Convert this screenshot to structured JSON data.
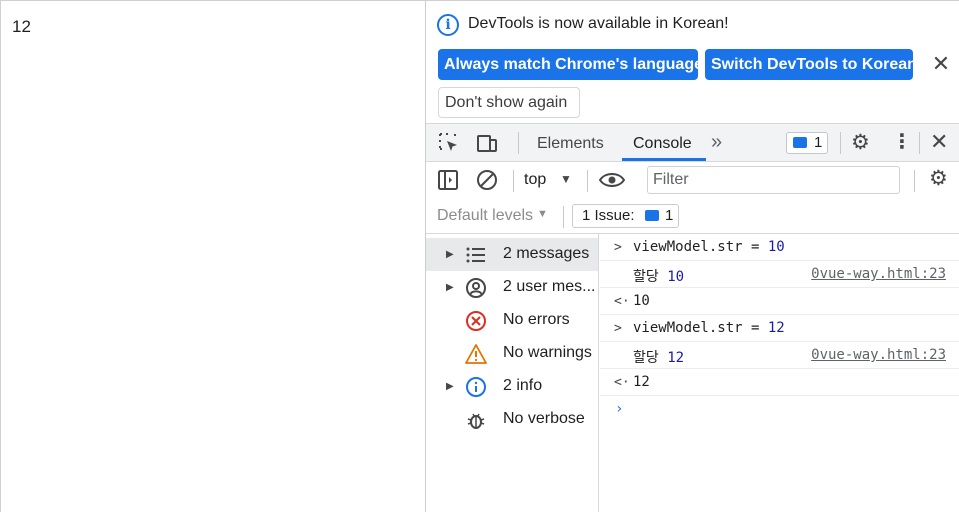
{
  "page": {
    "content_text": "12"
  },
  "infobar": {
    "message": "DevTools is now available in Korean!",
    "match_button": "Always match Chrome's language",
    "switch_button": "Switch DevTools to Korean",
    "dont_show_button": "Don't show again",
    "close_label": "✕"
  },
  "toolbar": {
    "tabs": [
      {
        "label": "Elements",
        "selected": false
      },
      {
        "label": "Console",
        "selected": true
      }
    ],
    "more_tabs_label": "»",
    "issues_count": "1",
    "close_label": "✕"
  },
  "console_toolbar": {
    "context": "top",
    "filter_placeholder": "Filter"
  },
  "levels_bar": {
    "default_levels": "Default levels",
    "issues_label": "1 Issue:",
    "issues_count": "1"
  },
  "sidebar": {
    "items": [
      {
        "label": "2 messages",
        "icon": "list-icon",
        "expandable": true,
        "selected": true
      },
      {
        "label": "2 user mes...",
        "icon": "user-icon",
        "expandable": true,
        "selected": false
      },
      {
        "label": "No errors",
        "icon": "error-icon",
        "expandable": false,
        "selected": false
      },
      {
        "label": "No warnings",
        "icon": "warning-icon",
        "expandable": false,
        "selected": false
      },
      {
        "label": "2 info",
        "icon": "info-icon",
        "expandable": true,
        "selected": false
      },
      {
        "label": "No verbose",
        "icon": "bug-icon",
        "expandable": false,
        "selected": false
      }
    ]
  },
  "console": {
    "entries": [
      {
        "kind": "input",
        "expr": "viewModel.str = ",
        "value": "10"
      },
      {
        "kind": "log",
        "text": "할당 ",
        "value": "10",
        "source": "0vue-way.html:23"
      },
      {
        "kind": "result",
        "value": "10"
      },
      {
        "kind": "input",
        "expr": "viewModel.str = ",
        "value": "12"
      },
      {
        "kind": "log",
        "text": "할당 ",
        "value": "12",
        "source": "0vue-way.html:23"
      },
      {
        "kind": "result",
        "value": "12"
      }
    ],
    "prompt": "›"
  },
  "colors": {
    "accent": "#1a73e8",
    "error": "#d93025",
    "warning": "#e37400",
    "number": "#1a1aa6"
  }
}
